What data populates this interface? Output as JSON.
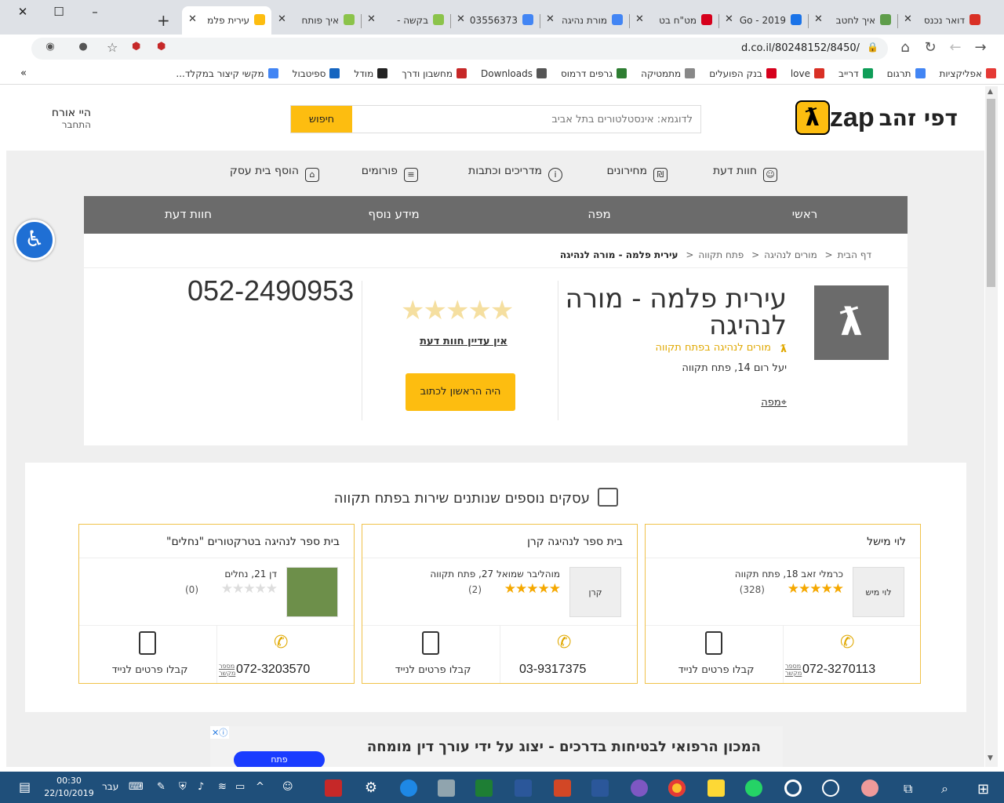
{
  "browser": {
    "tabs": [
      {
        "title": "דואר נכנס",
        "color": "#d93025"
      },
      {
        "title": "איך לחטב",
        "color": "#5f9d4b"
      },
      {
        "title": "2019 - Go",
        "color": "#1a73e8"
      },
      {
        "title": "מט\"ח בט",
        "color": "#d6001c"
      },
      {
        "title": "מורת נהיגה",
        "color": "#4285f4"
      },
      {
        "title": "03556373",
        "color": "#4285f4"
      },
      {
        "title": "בקשה -",
        "color": "#8bc34a"
      },
      {
        "title": "איך פותח",
        "color": "#8bc34a"
      },
      {
        "title": "עירית פלמ",
        "color": "#fdbd10"
      }
    ],
    "url": "d.co.il/80248152/8450/",
    "bookmarks": [
      {
        "label": "אפליקציות",
        "color": "#e53935"
      },
      {
        "label": "תרגום",
        "color": "#4285f4"
      },
      {
        "label": "דרייב",
        "color": "#0f9d58"
      },
      {
        "label": "love",
        "color": "#d93025"
      },
      {
        "label": "בנק הפועלים",
        "color": "#d6001c"
      },
      {
        "label": "מתמטיקה",
        "color": "#888888"
      },
      {
        "label": "גרפים דרמוס",
        "color": "#2e7d32"
      },
      {
        "label": "Downloads",
        "color": "#555555"
      },
      {
        "label": "מחשבון ודרך",
        "color": "#c62828"
      },
      {
        "label": "מודל",
        "color": "#222222"
      },
      {
        "label": "ספיטבול",
        "color": "#1565c0"
      },
      {
        "label": "מקשי קיצור במקלד...",
        "color": "#4285f4"
      }
    ],
    "bookmarks_more": "»"
  },
  "site": {
    "logo_text": "דפי זהב",
    "logo_brand": "zap",
    "logo_symbol": "ƛ",
    "search_placeholder": "לדוגמא: אינסטלטורים בתל אביב",
    "search_button": "חיפוש",
    "guest_hello": "היי אורח",
    "guest_login": "התחבר",
    "subnav": [
      "חוות דעת",
      "מחירונים",
      "מדריכים וכתבות",
      "פורומים",
      "הוסף בית עסק"
    ],
    "mainnav": [
      "ראשי",
      "מפה",
      "מידע נוסף",
      "חוות דעת"
    ]
  },
  "breadcrumbs": [
    "דף הבית",
    "מורים לנהיגה",
    "פתח תקווה",
    "עירית פלמה - מורה לנהיגה"
  ],
  "business": {
    "name": "עירית פלמה - מורה לנהיגה",
    "category": "מורים לנהיגה בפתח תקווה",
    "address": "יעל רום 14, פתח תקווה",
    "map_link": "מפה",
    "stars": "★★★★★",
    "no_reviews": "אין עדיין חוות דעת",
    "first_review_button": "היה הראשון לכתוב",
    "phone": "052-2490953"
  },
  "more_section": {
    "title": "עסקים נוספים שנותנים שירות בפתח תקווה",
    "items": [
      {
        "name": "לוי מישל",
        "address": "כרמלי זאב 18, פתח תקווה",
        "stars": "★★★★★",
        "count": "(328)",
        "thumb": "לוי מיש",
        "phone": "072-3270113",
        "phone_label": "מספר מקשר",
        "mobile": "קבלו פרטים לנייד"
      },
      {
        "name": "בית ספר לנהיגה קרן",
        "address": "מוהליבר שמואל 27, פתח תקווה",
        "stars": "★★★★★",
        "count": "(2)",
        "thumb": "קרן",
        "phone": "03-9317375",
        "phone_label": "",
        "mobile": "קבלו פרטים לנייד"
      },
      {
        "name": "בית ספר לנהיגה בטרקטורים \"נחלים\"",
        "address": "דן 21, נחלים",
        "stars": "★★★★★",
        "count": "(0)",
        "thumb": "",
        "phone": "072-3203570",
        "phone_label": "מספר מקשר",
        "mobile": "קבלו פרטים לנייד"
      }
    ]
  },
  "ad": {
    "text": "המכון הרפואי לבטיחות בדרכים - יצוג על ידי עורך דין מומחה",
    "button": "פתח"
  },
  "taskbar": {
    "time": "00:30",
    "date": "22/10/2019",
    "lang": "עבר"
  }
}
